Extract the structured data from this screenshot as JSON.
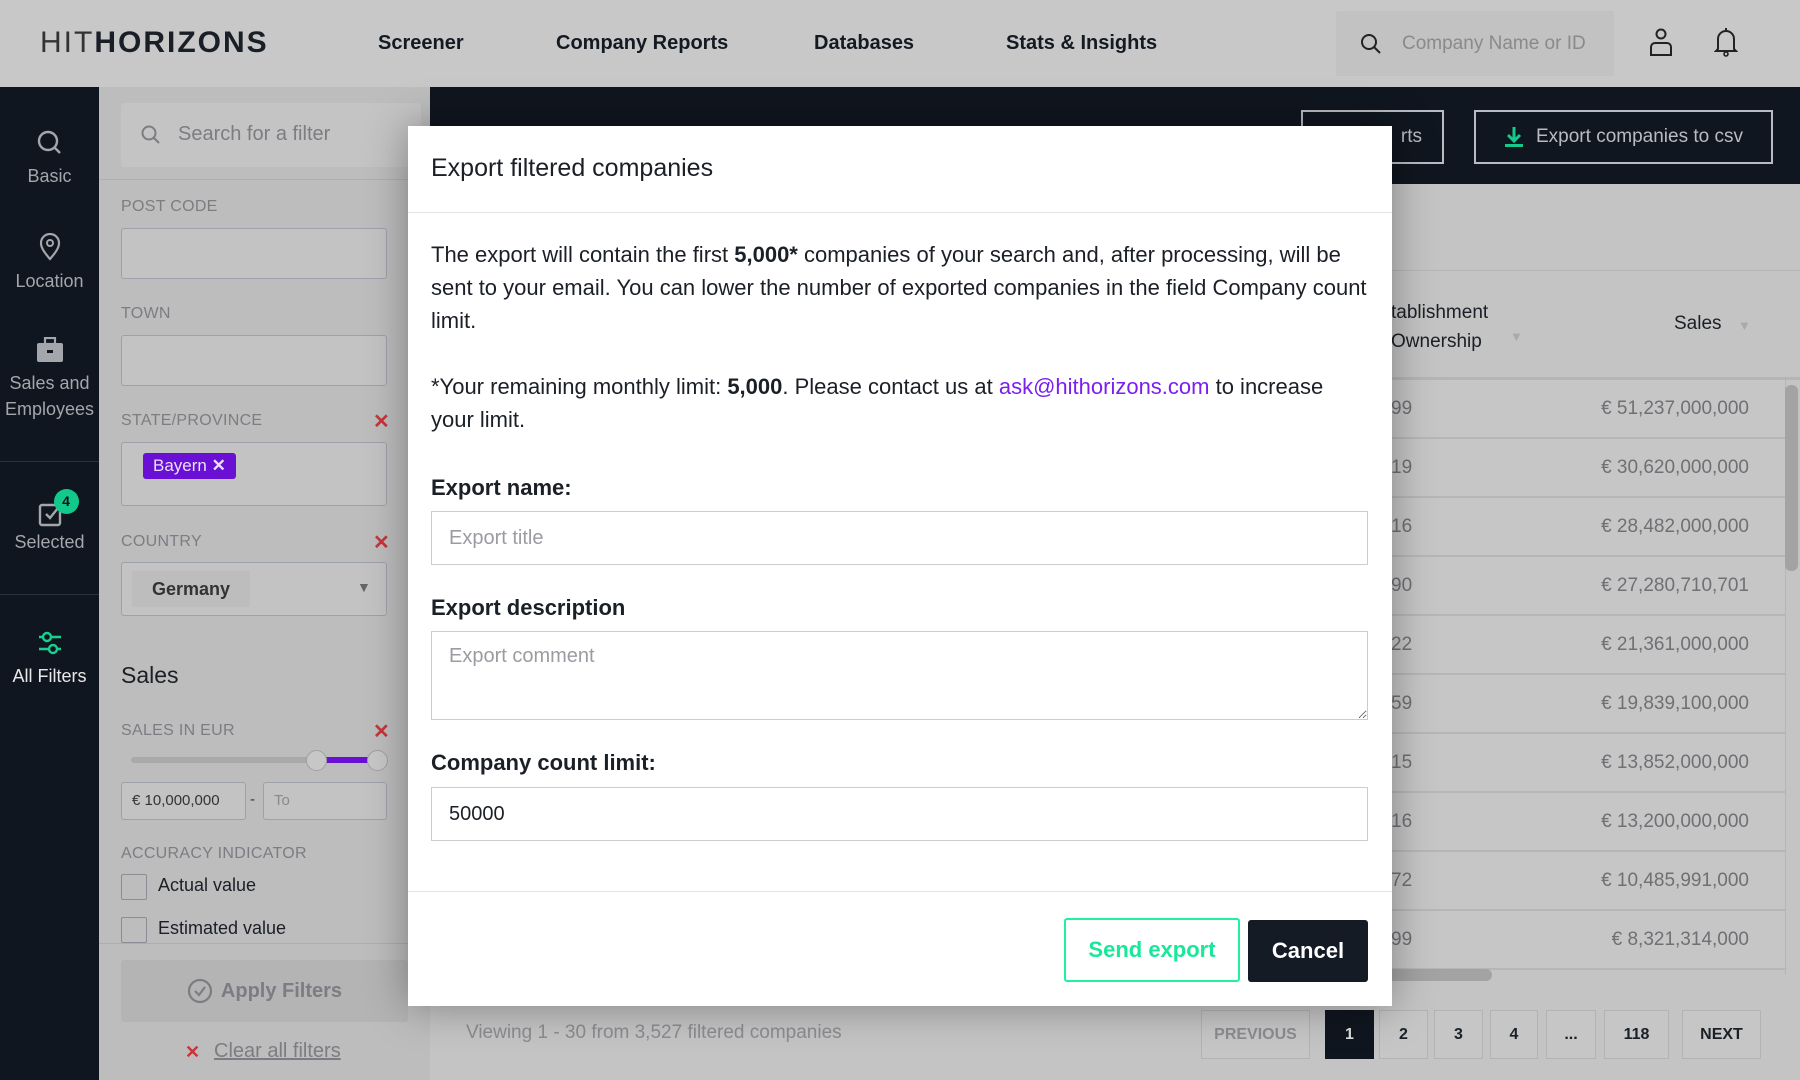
{
  "colors": {
    "accent_green": "#1df2a0",
    "brand_dark": "#10161f",
    "link_purple": "#7b1ff0",
    "tag_purple": "#6a10d4",
    "remove_red": "#c8353a"
  },
  "topbar": {
    "logo": "HITHORIZONS",
    "nav": [
      "Screener",
      "Company Reports",
      "Databases",
      "Stats & Insights"
    ],
    "search_placeholder": "Company Name or ID",
    "icons": [
      "search-icon",
      "user-icon",
      "bell-icon"
    ]
  },
  "leftnav": {
    "items": [
      {
        "label": "Basic",
        "icon": "search-icon"
      },
      {
        "label": "Location",
        "icon": "map-pin-icon"
      },
      {
        "label": "Sales and Employees",
        "icon": "briefcase-icon"
      },
      {
        "label": "Selected",
        "icon": "checkbox-icon",
        "badge": "4"
      },
      {
        "label": "All Filters",
        "icon": "sliders-icon"
      }
    ]
  },
  "filters": {
    "search_placeholder": "Search for a filter",
    "post_code_label": "POST CODE",
    "town_label": "TOWN",
    "state_label": "STATE/PROVINCE",
    "state_tag": "Bayern",
    "country_label": "COUNTRY",
    "country_value": "Germany",
    "sales_heading": "Sales",
    "sales_eur_label": "SALES IN EUR",
    "sales_from": "€ 10,000,000",
    "sales_to_placeholder": "To",
    "sales_dash": "-",
    "accuracy_label": "ACCURACY INDICATOR",
    "accuracy_options": [
      "Actual value",
      "Estimated value"
    ],
    "apply_label": "Apply Filters",
    "clear_label": "Clear all filters"
  },
  "main": {
    "export_reports_fragment": "rts",
    "export_csv_label": "Export companies to csv",
    "columns": {
      "establishment_line1": "tablishment",
      "establishment_line2": "Ownership",
      "sales": "Sales"
    },
    "rows": [
      {
        "c1": "99",
        "sales": "€ 51,237,000,000"
      },
      {
        "c1": "19",
        "sales": "€ 30,620,000,000"
      },
      {
        "c1": "16",
        "sales": "€ 28,482,000,000"
      },
      {
        "c1": "90",
        "sales": "€ 27,280,710,701"
      },
      {
        "c1": "22",
        "sales": "€ 21,361,000,000"
      },
      {
        "c1": "59",
        "sales": "€ 19,839,100,000"
      },
      {
        "c1": "15",
        "sales": "€ 13,852,000,000"
      },
      {
        "c1": "16",
        "sales": "€ 13,200,000,000"
      },
      {
        "c1": "72",
        "sales": "€ 10,485,991,000"
      },
      {
        "c1": "99",
        "sales": "€ 8,321,314,000"
      }
    ],
    "viewing": "Viewing 1 - 30 from 3,527 filtered companies",
    "pagination": {
      "previous": "PREVIOUS",
      "pages": [
        "1",
        "2",
        "3",
        "4",
        "...",
        "118"
      ],
      "current": "1",
      "next": "NEXT"
    }
  },
  "modal": {
    "title": "Export filtered companies",
    "p1_a": "The export will contain the first ",
    "p1_b": "5,000*",
    "p1_c": " companies of your search and, after processing, will be sent to your email. You can lower the number of exported companies in the field Company count limit.",
    "p2_a": "*Your remaining monthly limit: ",
    "p2_b": "5,000",
    "p2_c": ". Please contact us at ",
    "p2_link": "ask@hithorizons.com",
    "p2_d": " to increase your limit.",
    "name_label": "Export name:",
    "name_placeholder": "Export title",
    "desc_label": "Export description",
    "desc_placeholder": "Export comment",
    "count_label": "Company count limit:",
    "count_value": "50000",
    "send_label": "Send export",
    "cancel_label": "Cancel"
  }
}
